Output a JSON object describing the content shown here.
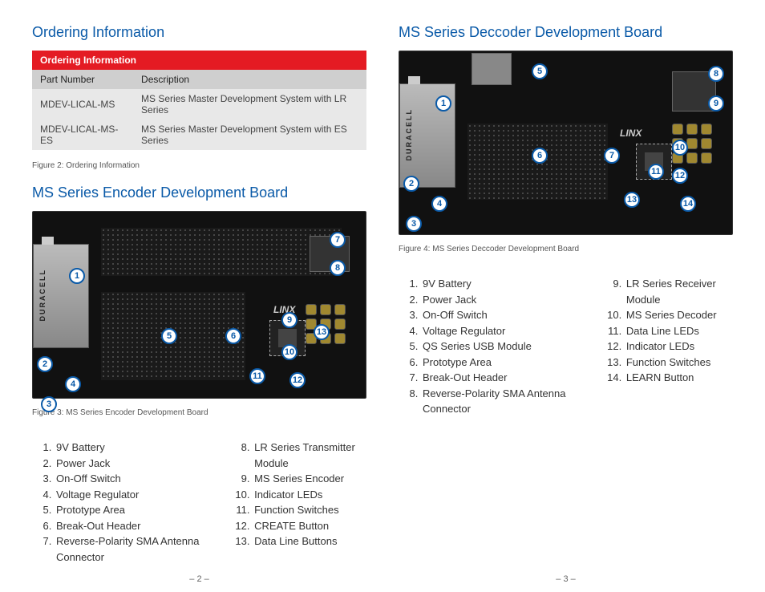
{
  "left": {
    "heading1": "Ordering Information",
    "table": {
      "title": "Ordering Information",
      "col1": "Part Number",
      "col2": "Description",
      "rows": [
        {
          "pn": "MDEV-LICAL-MS",
          "desc": "MS Series Master Development System with LR Series"
        },
        {
          "pn": "MDEV-LICAL-MS-ES",
          "desc": "MS Series Master Development System with ES Series"
        }
      ]
    },
    "caption1": "Figure 2: Ordering Information",
    "heading2": "MS Series Encoder Development Board",
    "caption2": "Figure 3: MS Series Encoder Development Board",
    "battery_label": "DURACELL",
    "linx_label": "LINX",
    "list_a": [
      "9V Battery",
      "Power Jack",
      "On-Off Switch",
      "Voltage Regulator",
      "Prototype Area",
      "Break-Out Header",
      "Reverse-Polarity SMA Antenna Connector"
    ],
    "list_b": [
      "LR Series Transmitter Module",
      "MS Series Encoder",
      "Indicator LEDs",
      "Function Switches",
      "CREATE Button",
      "Data Line Buttons"
    ],
    "pagenum": "– 2 –"
  },
  "right": {
    "heading1": "MS Series Deccoder Development Board",
    "caption1": "Figure 4: MS Series Deccoder Development Board",
    "battery_label": "DURACELL",
    "linx_label": "LINX",
    "list_a": [
      "9V Battery",
      "Power Jack",
      "On-Off Switch",
      "Voltage Regulator",
      "QS Series USB Module",
      "Prototype Area",
      "Break-Out Header",
      "Reverse-Polarity SMA Antenna Connector"
    ],
    "list_b": [
      "LR Series Receiver Module",
      "MS Series Decoder",
      "Data Line LEDs",
      "Indicator LEDs",
      "Function Switches",
      "LEARN Button"
    ],
    "pagenum": "– 3 –"
  }
}
